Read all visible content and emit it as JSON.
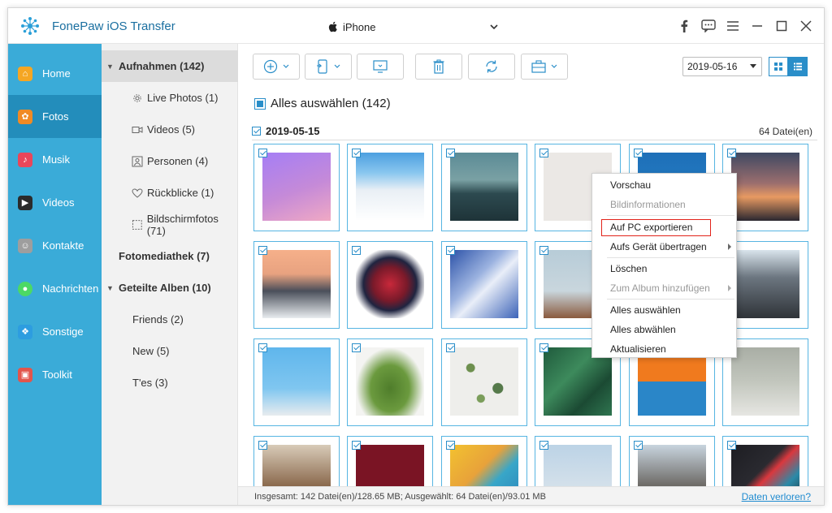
{
  "app": {
    "title": "FonePaw iOS Transfer",
    "device": "iPhone",
    "icons": [
      "logo-icon",
      "apple-icon",
      "facebook-icon",
      "feedback-icon",
      "menu-icon",
      "maximize-icon",
      "close-icon"
    ]
  },
  "nav": {
    "items": [
      {
        "label": "Home",
        "icon": "home-icon",
        "color": "#f5a623",
        "active": false
      },
      {
        "label": "Fotos",
        "icon": "photos-icon",
        "color": "#f08a24",
        "active": true
      },
      {
        "label": "Musik",
        "icon": "music-icon",
        "color": "#e9465a",
        "active": false
      },
      {
        "label": "Videos",
        "icon": "video-icon",
        "color": "#2b2b2b",
        "active": false
      },
      {
        "label": "Kontakte",
        "icon": "contacts-icon",
        "color": "#9e9e9e",
        "active": false
      },
      {
        "label": "Nachrichten",
        "icon": "messages-icon",
        "color": "#4cd964",
        "active": false
      },
      {
        "label": "Sonstige",
        "icon": "other-icon",
        "color": "#2d9de0",
        "active": false
      },
      {
        "label": "Toolkit",
        "icon": "toolkit-icon",
        "color": "#e2554c",
        "active": false
      }
    ],
    "active_color": "#238dbb",
    "bg_color": "#3aabd8"
  },
  "albums": {
    "aufnahmen": "Aufnahmen (142)",
    "live": "Live Photos (1)",
    "videos": "Videos (5)",
    "personen": "Personen (4)",
    "rueckblicke": "Rückblicke (1)",
    "bildschirmfotos": "Bildschirmfotos (71)",
    "fotomediathek": "Fotomediathek (7)",
    "geteilte": "Geteilte Alben (10)",
    "friends": "Friends (2)",
    "new": "New (5)",
    "tes": "T'es (3)"
  },
  "toolbar": {
    "date_value": "2019-05-16",
    "buttons": [
      "add-button",
      "export-to-device-button",
      "export-to-pc-button",
      "delete-button",
      "refresh-button",
      "toolbox-button"
    ]
  },
  "content": {
    "select_all": "Alles auswählen (142)",
    "date_group": "2019-05-15",
    "file_count": "64 Datei(en)"
  },
  "context_menu": {
    "vorschau": "Vorschau",
    "bildinfo": "Bildinformationen",
    "export_pc": "Auf PC exportieren",
    "transfer_device": "Aufs Gerät übertragen",
    "loeschen": "Löschen",
    "add_album": "Zum Album hinzufügen",
    "select_all": "Alles auswählen",
    "deselect_all": "Alles abwählen",
    "refresh": "Aktualisieren"
  },
  "status": {
    "text": "Insgesamt: 142 Datei(en)/128.65 MB; Ausgewählt: 64 Datei(en)/93.01 MB",
    "lost_link": "Daten verloren?"
  },
  "colors": {
    "accent": "#2a8ec9",
    "highlight_border": "#e2231a",
    "link": "#1f8bd0"
  }
}
